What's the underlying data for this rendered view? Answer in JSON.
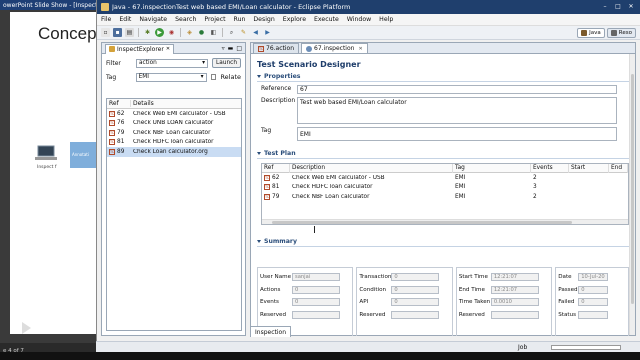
{
  "background": {
    "ppt_title": "owerPoint Slide Show - [Inspect.p",
    "slide_heading": "Concep",
    "laptop_label": "Inspect f",
    "box_label": "Annotati",
    "status_text": "e 4 of 7"
  },
  "window": {
    "title": "Java - 67.inspectionTest web based EMI/Loan calculator - Eclipse Platform",
    "menu": [
      "File",
      "Edit",
      "Navigate",
      "Search",
      "Project",
      "Run",
      "Design",
      "Explore",
      "Execute",
      "Window",
      "Help"
    ],
    "perspectives": [
      {
        "label": "Java",
        "active": true
      },
      {
        "label": "Reso",
        "active": false
      }
    ]
  },
  "explorer": {
    "tab_label": "InspectExplorer",
    "filter_label": "Filter",
    "filter_value": "action",
    "launch_label": "Launch",
    "tag_label": "Tag",
    "tag_value": "EMI",
    "relate_label": "Relate",
    "columns": [
      "Ref",
      "Details"
    ],
    "rows": [
      {
        "ref": "62",
        "details": "Check Web EMI calculator - USB",
        "selected": false
      },
      {
        "ref": "76",
        "details": "Check UNB LOAN calculator",
        "selected": false
      },
      {
        "ref": "79",
        "details": "Check NBF Loan calculator",
        "selected": false
      },
      {
        "ref": "81",
        "details": "Check HDFC loan calculator",
        "selected": false
      },
      {
        "ref": "89",
        "details": "Check Loan calculator.org",
        "selected": true
      }
    ]
  },
  "editor": {
    "tabs": [
      {
        "label": "76.action",
        "active": false
      },
      {
        "label": "67.inspection",
        "active": true
      }
    ],
    "form_title": "Test Scenario Designer",
    "properties": {
      "heading": "Properties",
      "reference_label": "Reference",
      "reference_value": "67",
      "description_label": "Description",
      "description_value": "Test web based EMI/Loan calculator",
      "tag_label": "Tag",
      "tag_value": "EMI"
    },
    "test_plan": {
      "heading": "Test Plan",
      "columns": [
        "Ref",
        "Description",
        "Tag",
        "Events",
        "Start",
        "End"
      ],
      "rows": [
        {
          "ref": "62",
          "description": "Check Web EMI calculator - USB",
          "tag": "EMI",
          "events": "2",
          "start": "",
          "end": ""
        },
        {
          "ref": "81",
          "description": "Check HDFC loan calculator",
          "tag": "EMI",
          "events": "3",
          "start": "",
          "end": ""
        },
        {
          "ref": "79",
          "description": "Check NBF Loan calculator",
          "tag": "EMI",
          "events": "2",
          "start": "",
          "end": ""
        }
      ]
    },
    "summary": {
      "heading": "Summary",
      "col1": [
        {
          "label": "User Name",
          "value": "sanjai"
        },
        {
          "label": "Actions",
          "value": "0"
        },
        {
          "label": "Events",
          "value": "0"
        },
        {
          "label": "Reserved",
          "value": ""
        }
      ],
      "col2": [
        {
          "label": "Transaction",
          "value": "0"
        },
        {
          "label": "Condition",
          "value": "0"
        },
        {
          "label": "API",
          "value": "0"
        },
        {
          "label": "Reserved",
          "value": ""
        }
      ],
      "col3": [
        {
          "label": "Start Time",
          "value": "12:21:07"
        },
        {
          "label": "End Time",
          "value": "12:21:07"
        },
        {
          "label": "Time Taken",
          "value": "0.0010"
        },
        {
          "label": "Reserved",
          "value": ""
        }
      ],
      "col4": [
        {
          "label": "Date",
          "value": "10-Jul-20"
        },
        {
          "label": "Passed",
          "value": "0"
        },
        {
          "label": "Failed",
          "value": "0"
        },
        {
          "label": "Status",
          "value": ""
        }
      ]
    }
  },
  "bottom_tab_label": "Inspection",
  "status_bar": {
    "job_label": "Job"
  },
  "colors": {
    "title_bar": "#1f3f6d",
    "selection": "#c9dcf3",
    "section_heading": "#2a4d7a"
  }
}
